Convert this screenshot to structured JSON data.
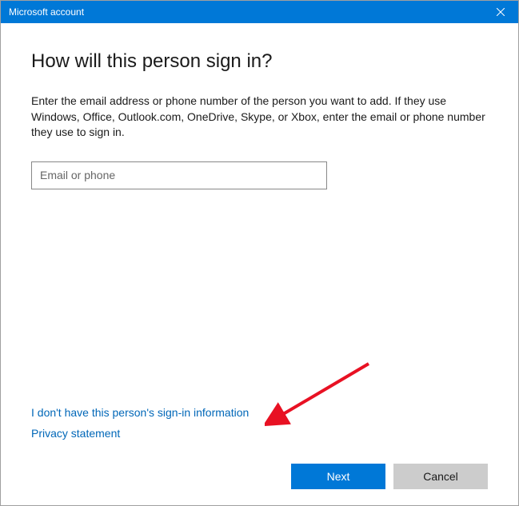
{
  "titlebar": {
    "title": "Microsoft account"
  },
  "content": {
    "heading": "How will this person sign in?",
    "description": "Enter the email address or phone number of the person you want to add. If they use Windows, Office, Outlook.com, OneDrive, Skype, or Xbox, enter the email or phone number they use to sign in.",
    "input_placeholder": "Email or phone"
  },
  "links": {
    "no_info": "I don't have this person's sign-in information",
    "privacy": "Privacy statement"
  },
  "buttons": {
    "next": "Next",
    "cancel": "Cancel"
  }
}
